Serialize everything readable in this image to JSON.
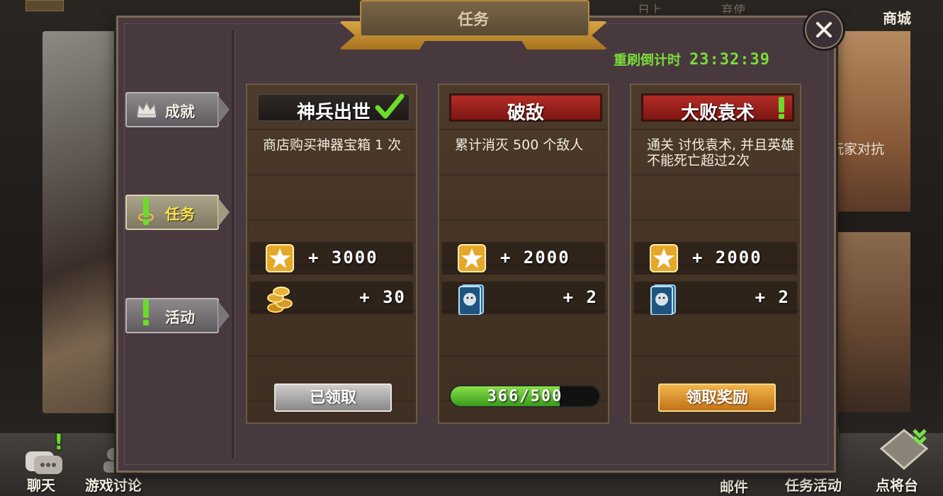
{
  "dialog": {
    "title": "任务",
    "refresh_label": "重刷倒计时",
    "refresh_timer": "23:32:39"
  },
  "sidebar": {
    "tabs": [
      {
        "label": "成就",
        "icon": "crown-icon",
        "active": false,
        "alert": false
      },
      {
        "label": "任务",
        "icon": "exclamation-icon",
        "active": true,
        "alert": true
      },
      {
        "label": "活动",
        "icon": "exclamation-icon",
        "active": false,
        "alert": true
      }
    ]
  },
  "quests": [
    {
      "title": "神兵出世",
      "status": "completed",
      "description": "商店购买神器宝箱 1 次",
      "rewards": [
        {
          "icon": "star-icon",
          "value": "+ 3000"
        },
        {
          "icon": "gold-coins-icon",
          "value": "+ 30"
        }
      ],
      "button_label": "已领取"
    },
    {
      "title": "破敌",
      "status": "in_progress",
      "description": "累计消灭 500 个敌人",
      "rewards": [
        {
          "icon": "star-icon",
          "value": "+ 2000"
        },
        {
          "icon": "tiger-card-icon",
          "value": "+ 2"
        }
      ],
      "progress_text": "366/500",
      "progress_fraction": 0.732
    },
    {
      "title": "大败袁术",
      "status": "claimable",
      "description": "通关 讨伐袁术, 并且英雄不能死亡超过2次",
      "rewards": [
        {
          "icon": "star-icon",
          "value": "+ 2000"
        },
        {
          "icon": "tiger-card-icon",
          "value": "+ 2"
        }
      ],
      "button_label": "领取奖励"
    }
  ],
  "background": {
    "shop_label": "商城",
    "right_label": "玩家对抗",
    "top_frag_1": "日上",
    "top_frag_2": "弃使"
  },
  "bottom_nav": {
    "chat": "聊天",
    "discussion": "游戏讨论",
    "mail": "邮件",
    "tasks": "任务活动",
    "generals": "点将台"
  },
  "colors": {
    "accent_green": "#6bdc2a",
    "title_red": "#b42c26",
    "claim_gold": "#f2b44a"
  }
}
